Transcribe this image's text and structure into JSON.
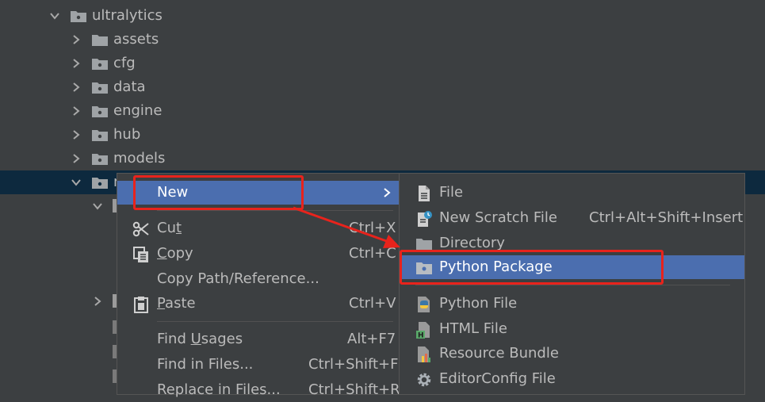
{
  "tree": {
    "root": "ultralytics",
    "children": [
      "assets",
      "cfg",
      "data",
      "engine",
      "hub",
      "models"
    ],
    "selected_partial": "n"
  },
  "context_menu": {
    "new": "New",
    "cut": {
      "prefix": "Cu",
      "mnemonic": "t",
      "suffix": "",
      "shortcut": "Ctrl+X"
    },
    "copy": {
      "prefix": "",
      "mnemonic": "C",
      "suffix": "opy",
      "shortcut": "Ctrl+C"
    },
    "copy_path": "Copy Path/Reference...",
    "paste": {
      "prefix": "",
      "mnemonic": "P",
      "suffix": "aste",
      "shortcut": "Ctrl+V"
    },
    "find_usages": {
      "prefix": "Find ",
      "mnemonic": "U",
      "suffix": "sages",
      "shortcut": "Alt+F7"
    },
    "find_in_files": {
      "label": "Find in Files...",
      "shortcut": "Ctrl+Shift+F"
    },
    "replace_in_files": {
      "label": "Replace in Files...",
      "shortcut": "Ctrl+Shift+R"
    }
  },
  "submenu": {
    "file": "File",
    "scratch": {
      "label": "New Scratch File",
      "shortcut": "Ctrl+Alt+Shift+Insert"
    },
    "directory": "Directory",
    "python_package": "Python Package",
    "python_file": "Python File",
    "html_file": "HTML File",
    "resource_bundle": "Resource Bundle",
    "editorconfig": "EditorConfig File"
  },
  "colors": {
    "background": "#3c3f41",
    "selection": "#4b6eaf",
    "tree_selection": "#0d293e",
    "annotation_red": "#e8231c"
  }
}
